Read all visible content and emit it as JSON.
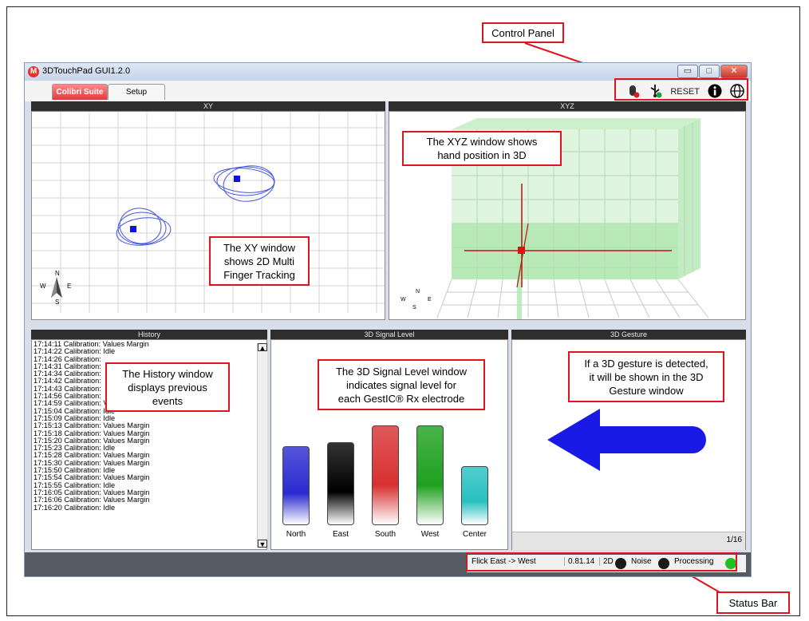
{
  "window": {
    "title": "3DTouchPad GUI1.2.0",
    "logo": "microchip-logo-icon",
    "minimize": "▭",
    "maximize": "□",
    "close": "✕"
  },
  "tabs": [
    {
      "label": "Colibri Suite",
      "active": true
    },
    {
      "label": "Setup",
      "active": false
    }
  ],
  "control_panel": {
    "icons": [
      "mouse-icon",
      "usb-icon",
      "info-icon",
      "globe-icon"
    ],
    "reset_label": "RESET"
  },
  "callouts": {
    "control_panel": "Control Panel",
    "xyz": "The XYZ window shows\nhand position in 3D",
    "xy": "The XY window\nshows 2D Multi\nFinger Tracking",
    "history": "The History window\ndisplays previous\nevents",
    "signal": "The 3D Signal Level window\nindicates signal level for\neach GestIC® Rx electrode",
    "gesture": "If a 3D gesture is detected,\nit will be shown in the 3D\nGesture window",
    "status_bar": "Status Bar"
  },
  "panes": {
    "xy": {
      "title": "XY",
      "compass": {
        "n": "N",
        "s": "S",
        "e": "E",
        "w": "W"
      }
    },
    "xyz": {
      "title": "XYZ",
      "compass": {
        "n": "N",
        "s": "S",
        "e": "E",
        "w": "W"
      }
    },
    "history": {
      "title": "History",
      "entries": [
        "17:14:11 Calibration: Values Margin",
        "17:14:22 Calibration: Idle",
        "17:14:26 Calibration:",
        "17:14:31 Calibration:",
        "17:14:34 Calibration:",
        "17:14:42 Calibration:",
        "17:14:43 Calibration:",
        "17:14:56 Calibration:",
        "17:14:59 Calibration: Values Margin",
        "17:15:04 Calibration: Idle",
        "17:15:09 Calibration: Idle",
        "17:15:13 Calibration: Values Margin",
        "17:15:18 Calibration: Values Margin",
        "17:15:20 Calibration: Values Margin",
        "17:15:23 Calibration: Idle",
        "17:15:28 Calibration: Values Margin",
        "17:15:30 Calibration: Values Margin",
        "17:15:50 Calibration: Idle",
        "17:15:54 Calibration: Values Margin",
        "17:15:55 Calibration: Idle",
        "17:16:05 Calibration: Values Margin",
        "17:16:06 Calibration: Values Margin",
        "17:16:20 Calibration: Idle"
      ]
    },
    "signal": {
      "title": "3D Signal Level",
      "bars": [
        {
          "label": "North",
          "level": 0.62,
          "color": "#2a2ad0"
        },
        {
          "label": "East",
          "level": 0.65,
          "color": "#000000"
        },
        {
          "label": "South",
          "level": 0.78,
          "color": "#d83030"
        },
        {
          "label": "West",
          "level": 0.78,
          "color": "#1ea01e"
        },
        {
          "label": "Center",
          "level": 0.46,
          "color": "#28c0c0"
        }
      ]
    },
    "gesture": {
      "title": "3D Gesture",
      "direction": "west",
      "page": "1/16"
    }
  },
  "status_bar": {
    "gesture": "Flick East -> West",
    "version": "0.81.14",
    "indicators": [
      {
        "label": "2D",
        "color": "#1a1a1a"
      },
      {
        "label": "Noise",
        "color": "#1a1a1a"
      },
      {
        "label": "Processing",
        "color": "#22c022"
      }
    ]
  }
}
